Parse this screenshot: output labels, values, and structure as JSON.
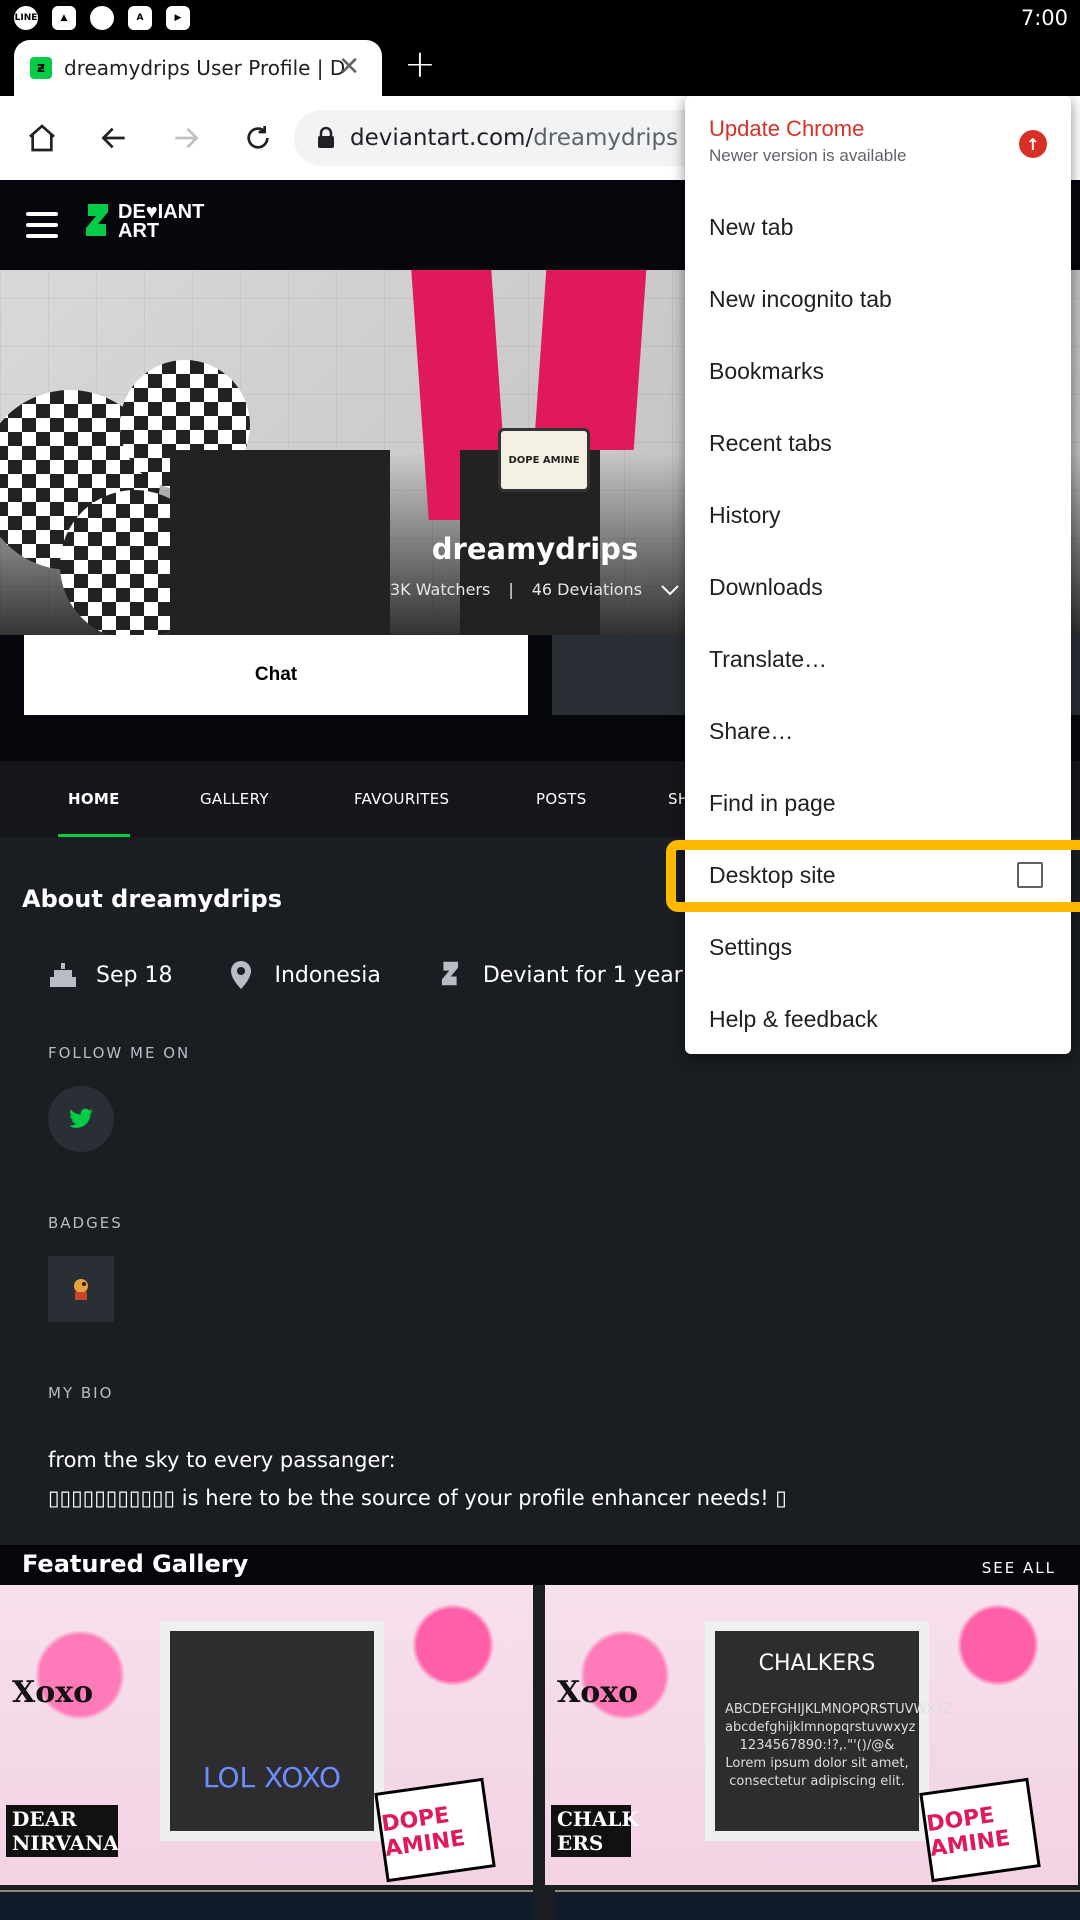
{
  "status_bar": {
    "time": "7:00",
    "icons": [
      "line-icon",
      "gallery-icon",
      "chat-icon",
      "store-icon",
      "play-store-icon"
    ]
  },
  "tab": {
    "title": "dreamydrips User Profile | De",
    "close": "✕",
    "new_tab": "+"
  },
  "toolbar": {
    "url_host": "deviantart.com/",
    "url_path": "dreamydrips"
  },
  "site": {
    "logo_line1": "DE♥IANT",
    "logo_line2": "ART",
    "avatar_text": "DOPE AMINE",
    "username": "dreamydrips",
    "watchers": "3K Watchers",
    "separator": "|",
    "deviations": "46 Deviations",
    "chat_button": "Chat",
    "nav_tabs": [
      "HOME",
      "GALLERY",
      "FAVOURITES",
      "POSTS",
      "SH"
    ],
    "about_title": "About dreamydrips",
    "birthday": "Sep 18",
    "location": "Indonesia",
    "deviant_for": "Deviant for 1 year",
    "follow_label": "FOLLOW ME ON",
    "badges_label": "BADGES",
    "bio_label": "MY BIO",
    "bio_line1": "from the sky to every passanger:",
    "bio_line2": "▯▯▯▯▯▯▯▯▯▯▯ is here to be the source of your profile enhancer needs! ▯",
    "featured_title": "Featured Gallery",
    "see_all": "SEE ALL",
    "thumb1_caption": "LOL  XOXO",
    "thumb1_corner": "DEAR NIRVANA",
    "thumb2_title": "CHALKERS",
    "thumb2_sub": "ABCDEFGHIJKLMNOPQRSTUVWXYZ abcdefghijklmnopqrstuvwxyz 1234567890:!?,.\"'()/@& Lorem ipsum dolor sit amet, consectetur adipiscing elit.",
    "thumb2_corner": "CHALK ERS",
    "stamp_text": "DOPE AMINE",
    "xoxo": "Xoxo"
  },
  "menu": {
    "update_title": "Update Chrome",
    "update_sub": "Newer version is available",
    "items": [
      "New tab",
      "New incognito tab",
      "Bookmarks",
      "Recent tabs",
      "History",
      "Downloads",
      "Translate…",
      "Share…",
      "Find in page",
      "Desktop site",
      "Settings",
      "Help & feedback"
    ]
  },
  "colors": {
    "accent_green": "#05cc47",
    "highlight": "#ffb900",
    "update_red": "#d93025"
  }
}
